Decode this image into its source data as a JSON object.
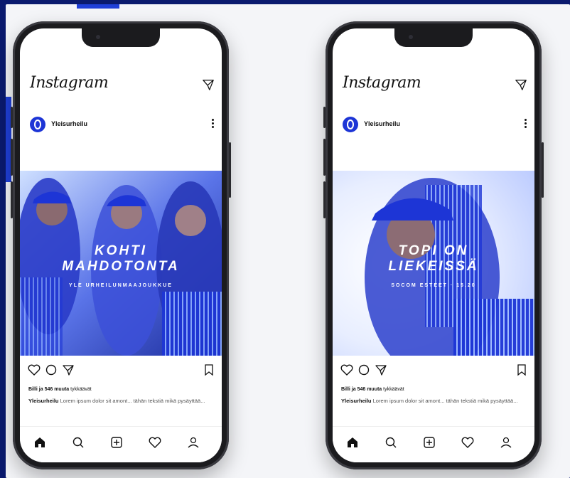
{
  "colors": {
    "frame_background": "#0a1a6e",
    "brand_blue": "#1d35d6",
    "phone_body": "#1b1b1e"
  },
  "phones": [
    {
      "app_title": "Instagram",
      "username": "Yleisurheilu",
      "overlay": {
        "line1": "KOHTI",
        "line2": "MAHDOTONTA",
        "line3": "YLE URHEILUNMAAJOUKKUE"
      },
      "likes_user": "Billi",
      "likes_rest": "ja 546 muuta",
      "likes_suffix": "tykkäävät",
      "caption_user": "Yleisurheilu",
      "caption_text": "Lorem ipsum dolor sit amont... tähän tekstiä mikä pysäyttää..."
    },
    {
      "app_title": "Instagram",
      "username": "Yleisurheilu",
      "overlay": {
        "line1": "TOPI ON",
        "line2": "LIEKEISSÄ",
        "line3": "SOCOM ESTEET · 15.20"
      },
      "likes_user": "Billi",
      "likes_rest": "ja 546 muuta",
      "likes_suffix": "tykkäävät",
      "caption_user": "Yleisurheilu",
      "caption_text": "Lorem ipsum dolor sit amont... tähän tekstiä mikä pysäyttää..."
    }
  ],
  "icons": {
    "header": "send-icon",
    "post_actions": [
      "heart-icon",
      "comment-icon",
      "share-icon",
      "bookmark-icon"
    ],
    "bottom_nav": [
      "home-icon",
      "search-icon",
      "add-post-icon",
      "activity-heart-icon",
      "profile-icon"
    ]
  }
}
